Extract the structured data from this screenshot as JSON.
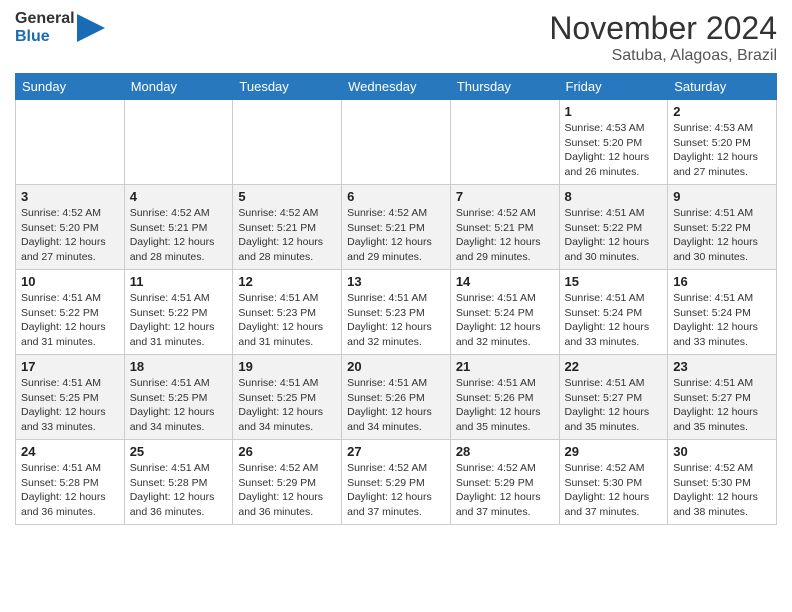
{
  "header": {
    "logo_general": "General",
    "logo_blue": "Blue",
    "month_title": "November 2024",
    "location": "Satuba, Alagoas, Brazil"
  },
  "weekdays": [
    "Sunday",
    "Monday",
    "Tuesday",
    "Wednesday",
    "Thursday",
    "Friday",
    "Saturday"
  ],
  "weeks": [
    [
      {
        "day": "",
        "info": ""
      },
      {
        "day": "",
        "info": ""
      },
      {
        "day": "",
        "info": ""
      },
      {
        "day": "",
        "info": ""
      },
      {
        "day": "",
        "info": ""
      },
      {
        "day": "1",
        "info": "Sunrise: 4:53 AM\nSunset: 5:20 PM\nDaylight: 12 hours and 26 minutes."
      },
      {
        "day": "2",
        "info": "Sunrise: 4:53 AM\nSunset: 5:20 PM\nDaylight: 12 hours and 27 minutes."
      }
    ],
    [
      {
        "day": "3",
        "info": "Sunrise: 4:52 AM\nSunset: 5:20 PM\nDaylight: 12 hours and 27 minutes."
      },
      {
        "day": "4",
        "info": "Sunrise: 4:52 AM\nSunset: 5:21 PM\nDaylight: 12 hours and 28 minutes."
      },
      {
        "day": "5",
        "info": "Sunrise: 4:52 AM\nSunset: 5:21 PM\nDaylight: 12 hours and 28 minutes."
      },
      {
        "day": "6",
        "info": "Sunrise: 4:52 AM\nSunset: 5:21 PM\nDaylight: 12 hours and 29 minutes."
      },
      {
        "day": "7",
        "info": "Sunrise: 4:52 AM\nSunset: 5:21 PM\nDaylight: 12 hours and 29 minutes."
      },
      {
        "day": "8",
        "info": "Sunrise: 4:51 AM\nSunset: 5:22 PM\nDaylight: 12 hours and 30 minutes."
      },
      {
        "day": "9",
        "info": "Sunrise: 4:51 AM\nSunset: 5:22 PM\nDaylight: 12 hours and 30 minutes."
      }
    ],
    [
      {
        "day": "10",
        "info": "Sunrise: 4:51 AM\nSunset: 5:22 PM\nDaylight: 12 hours and 31 minutes."
      },
      {
        "day": "11",
        "info": "Sunrise: 4:51 AM\nSunset: 5:22 PM\nDaylight: 12 hours and 31 minutes."
      },
      {
        "day": "12",
        "info": "Sunrise: 4:51 AM\nSunset: 5:23 PM\nDaylight: 12 hours and 31 minutes."
      },
      {
        "day": "13",
        "info": "Sunrise: 4:51 AM\nSunset: 5:23 PM\nDaylight: 12 hours and 32 minutes."
      },
      {
        "day": "14",
        "info": "Sunrise: 4:51 AM\nSunset: 5:24 PM\nDaylight: 12 hours and 32 minutes."
      },
      {
        "day": "15",
        "info": "Sunrise: 4:51 AM\nSunset: 5:24 PM\nDaylight: 12 hours and 33 minutes."
      },
      {
        "day": "16",
        "info": "Sunrise: 4:51 AM\nSunset: 5:24 PM\nDaylight: 12 hours and 33 minutes."
      }
    ],
    [
      {
        "day": "17",
        "info": "Sunrise: 4:51 AM\nSunset: 5:25 PM\nDaylight: 12 hours and 33 minutes."
      },
      {
        "day": "18",
        "info": "Sunrise: 4:51 AM\nSunset: 5:25 PM\nDaylight: 12 hours and 34 minutes."
      },
      {
        "day": "19",
        "info": "Sunrise: 4:51 AM\nSunset: 5:25 PM\nDaylight: 12 hours and 34 minutes."
      },
      {
        "day": "20",
        "info": "Sunrise: 4:51 AM\nSunset: 5:26 PM\nDaylight: 12 hours and 34 minutes."
      },
      {
        "day": "21",
        "info": "Sunrise: 4:51 AM\nSunset: 5:26 PM\nDaylight: 12 hours and 35 minutes."
      },
      {
        "day": "22",
        "info": "Sunrise: 4:51 AM\nSunset: 5:27 PM\nDaylight: 12 hours and 35 minutes."
      },
      {
        "day": "23",
        "info": "Sunrise: 4:51 AM\nSunset: 5:27 PM\nDaylight: 12 hours and 35 minutes."
      }
    ],
    [
      {
        "day": "24",
        "info": "Sunrise: 4:51 AM\nSunset: 5:28 PM\nDaylight: 12 hours and 36 minutes."
      },
      {
        "day": "25",
        "info": "Sunrise: 4:51 AM\nSunset: 5:28 PM\nDaylight: 12 hours and 36 minutes."
      },
      {
        "day": "26",
        "info": "Sunrise: 4:52 AM\nSunset: 5:29 PM\nDaylight: 12 hours and 36 minutes."
      },
      {
        "day": "27",
        "info": "Sunrise: 4:52 AM\nSunset: 5:29 PM\nDaylight: 12 hours and 37 minutes."
      },
      {
        "day": "28",
        "info": "Sunrise: 4:52 AM\nSunset: 5:29 PM\nDaylight: 12 hours and 37 minutes."
      },
      {
        "day": "29",
        "info": "Sunrise: 4:52 AM\nSunset: 5:30 PM\nDaylight: 12 hours and 37 minutes."
      },
      {
        "day": "30",
        "info": "Sunrise: 4:52 AM\nSunset: 5:30 PM\nDaylight: 12 hours and 38 minutes."
      }
    ]
  ]
}
